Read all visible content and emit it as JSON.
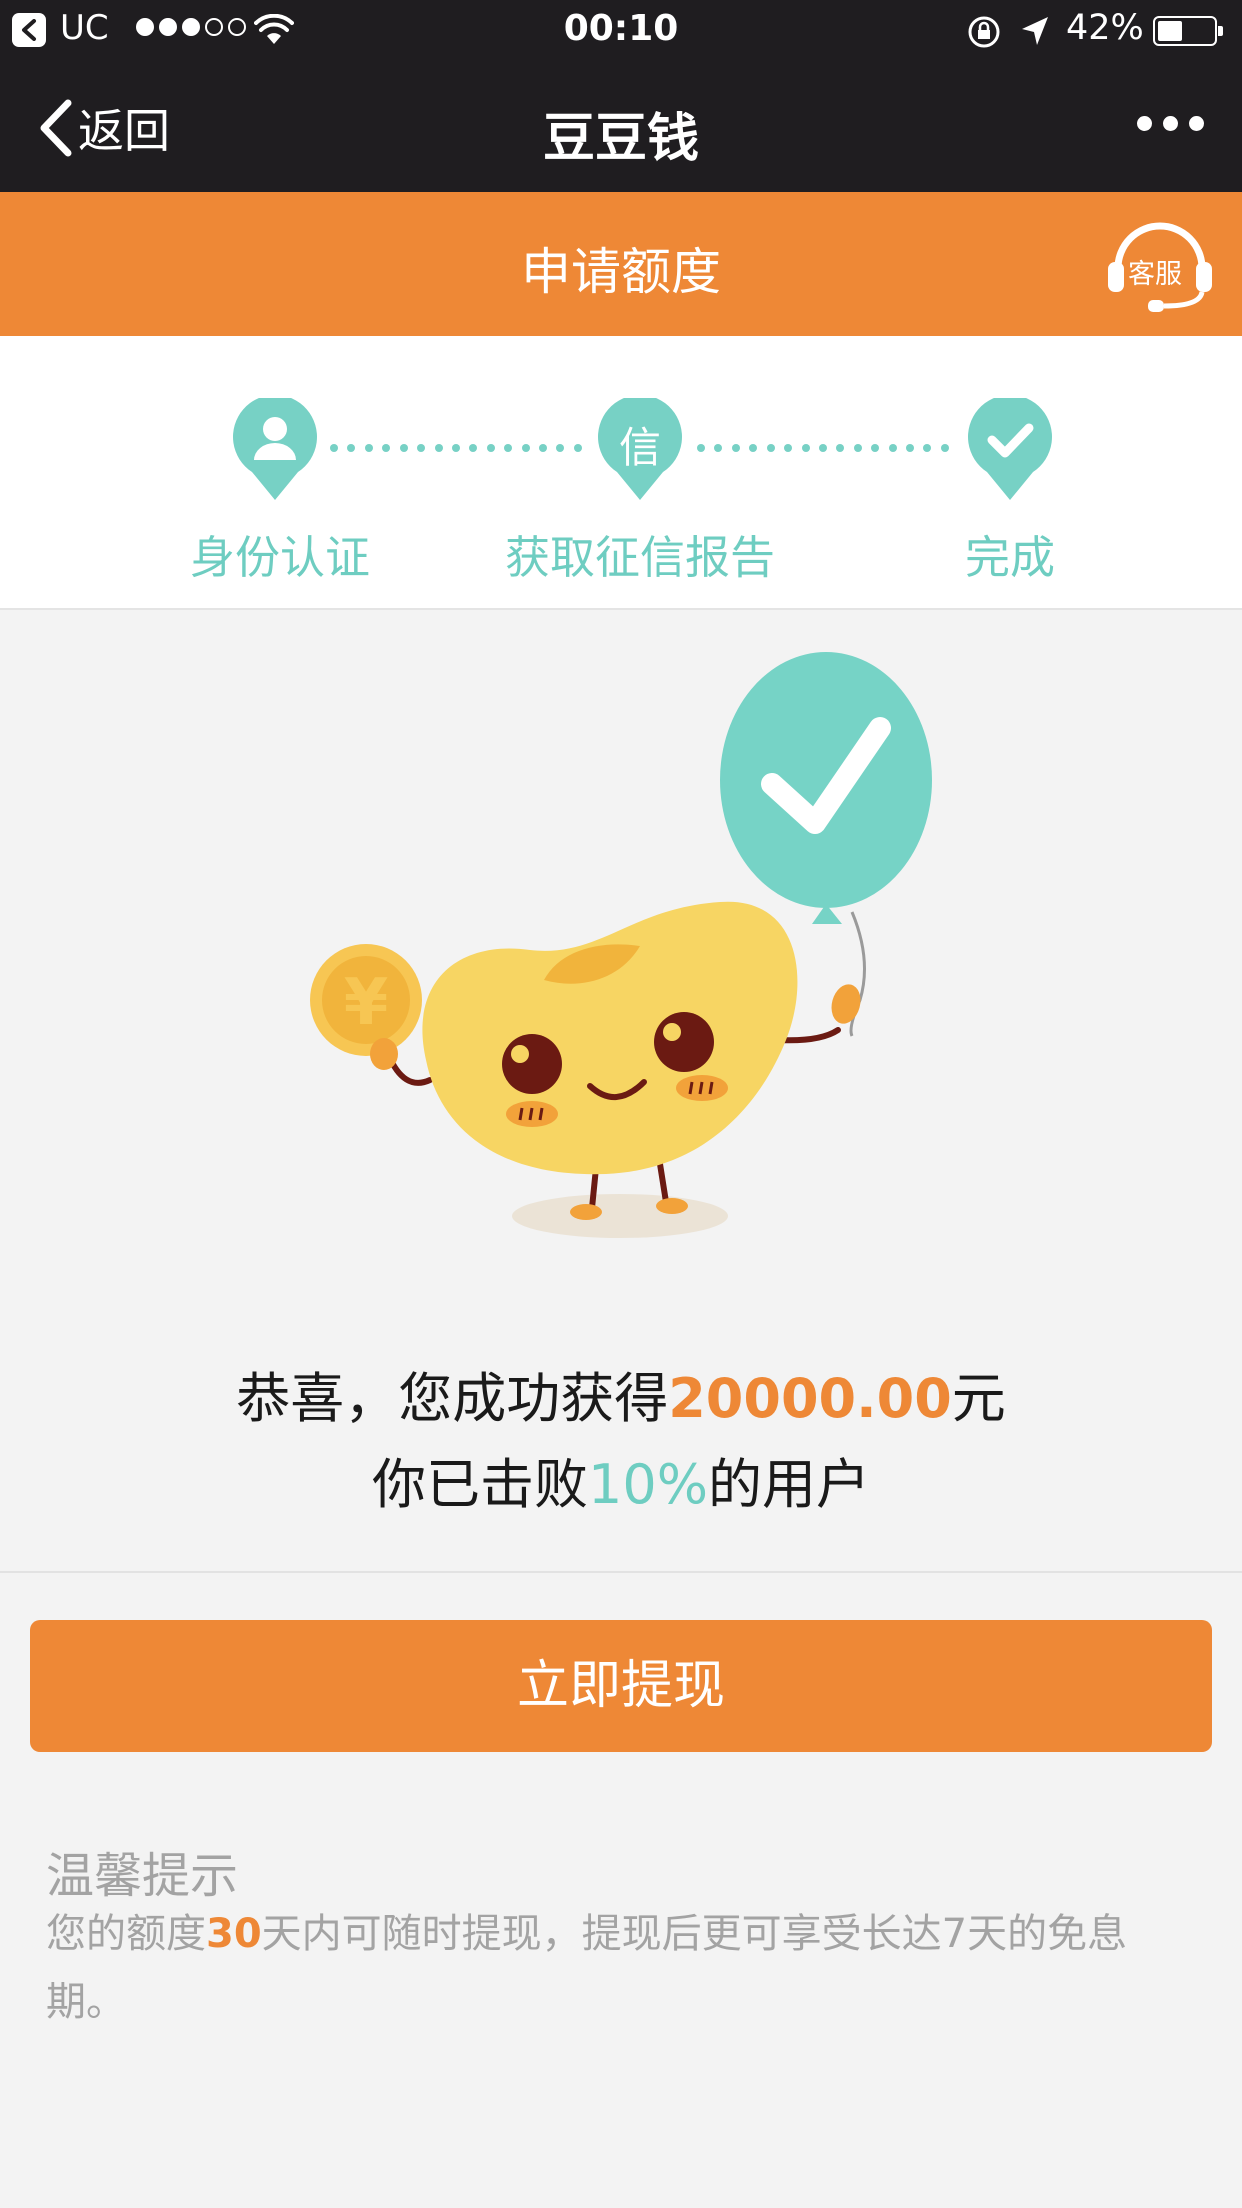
{
  "status_bar": {
    "app": "UC",
    "time": "00:10",
    "battery": "42%"
  },
  "nav": {
    "back_label": "返回",
    "title": "豆豆钱"
  },
  "sub_header": {
    "title": "申请额度",
    "customer_service": "客服"
  },
  "steps": {
    "items": [
      {
        "label": "身份认证",
        "icon": "person-icon"
      },
      {
        "label": "获取征信报告",
        "icon_text": "信"
      },
      {
        "label": "完成",
        "icon": "check-icon"
      }
    ]
  },
  "result": {
    "line1_prefix": "恭喜，您成功获得",
    "amount": "20000.00",
    "line1_suffix": "元",
    "line2_prefix": "你已击败",
    "percent": "10%",
    "line2_suffix": "的用户"
  },
  "withdraw_button": "立即提现",
  "tips": {
    "title": "温馨提示",
    "text_prefix": "您的额度",
    "days": "30",
    "text_suffix": "天内可随时提现，提现后更可享受长达7天的免息期。"
  },
  "colors": {
    "orange": "#ee8836",
    "teal": "#6ecdc1",
    "dark": "#1f1d20"
  }
}
